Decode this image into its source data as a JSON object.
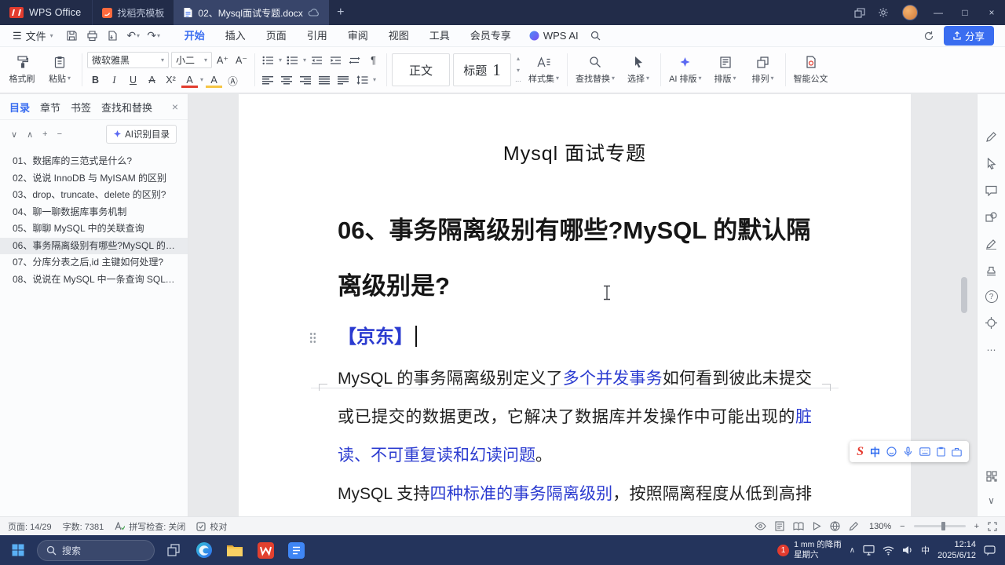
{
  "colors": {
    "accent": "#3a6df0",
    "navy": "#222c49",
    "taskbar": "#24345c",
    "link": "#2b3bd0",
    "danger": "#e23c2e"
  },
  "icons": {
    "dropdown": "▾",
    "up": "▴",
    "more": "⋯",
    "plus": "+",
    "minus": "−",
    "close": "×",
    "minimize": "—",
    "maximize": "□",
    "undo": "↶",
    "redo": "↷",
    "hamburger": "☰",
    "chevron_up": "∧",
    "chevron_down": "∨",
    "pilcrow": "¶",
    "help": "?"
  },
  "titlebar": {
    "app_name": "WPS Office",
    "home_tab": "找稻壳模板",
    "doc_tab": "02、Mysql面试专题.docx"
  },
  "menubar": {
    "menu": "文件",
    "tabs": [
      "开始",
      "插入",
      "页面",
      "引用",
      "审阅",
      "视图",
      "工具",
      "会员专享"
    ],
    "ai_tab": "WPS AI",
    "share": "分享"
  },
  "ribbon": {
    "format_painter": "格式刷",
    "paste": "粘贴",
    "font_name": "微软雅黑",
    "font_size": "小二",
    "glyphs": {
      "grow": "A⁺",
      "shrink": "A⁻",
      "bold": "B",
      "italic": "I",
      "underline": "U",
      "strike": "A",
      "supsub": "X²",
      "fontcolor": "A",
      "highlight": "A",
      "shading": "Ⓐ"
    },
    "style_normal": "正文",
    "style_heading_prefix": "标题",
    "style_heading_num": "1",
    "style_set": "样式集",
    "find_replace": "查找替换",
    "select": "选择",
    "ai_layout": "AI 排版",
    "layout": "排版",
    "arrange": "排列",
    "smart_doc": "智能公文"
  },
  "sidebar": {
    "tabs": [
      "目录",
      "章节",
      "书签",
      "查找和替换"
    ],
    "ai_recognize": "AI识别目录",
    "items": [
      {
        "label": "01、数据库的三范式是什么?"
      },
      {
        "label": "02、说说 InnoDB 与 MyISAM 的区别"
      },
      {
        "label": "03、drop、truncate、delete 的区别?"
      },
      {
        "label": "04、聊一聊数据库事务机制"
      },
      {
        "label": "05、聊聊 MySQL 中的关联查询"
      },
      {
        "label": "06、事务隔离级别有哪些?MySQL 的默认..."
      },
      {
        "label": "07、分库分表之后,id 主键如何处理?"
      },
      {
        "label": "08、说说在 MySQL 中一条查询 SQL 是..."
      }
    ]
  },
  "document": {
    "title": "Mysql 面试专题",
    "heading": "06、事务隔离级别有哪些?MySQL 的默认隔离级别是?",
    "tag": "【京东】",
    "p1": {
      "s1": "MySQL 的事务隔离级别定义了",
      "s2": "多个并发事务",
      "s3": "如何看到彼此未提交或已提交的数据更改，它解决了数据库并发操作中可能出现的",
      "s4": "脏读、不可重复读和幻读问题",
      "s5": "。"
    },
    "p2": {
      "s1": "MySQL 支持",
      "s2": "四种标准的事务隔离级别",
      "s3": "，按照隔离程度从低到高排列如下："
    }
  },
  "ime": {
    "logo": "S",
    "mode": "中"
  },
  "statusbar": {
    "page": "页面: 14/29",
    "words": "字数: 7381",
    "spellcheck": "拼写检查: 关闭",
    "proofread": "校对",
    "zoom": "130%"
  },
  "taskbar": {
    "search_placeholder": "搜索",
    "badge": "1",
    "weather_line1": "1 mm 的降雨",
    "weather_line2": "星期六",
    "ime": "中",
    "time": "12:14",
    "date": "2025/6/12"
  }
}
